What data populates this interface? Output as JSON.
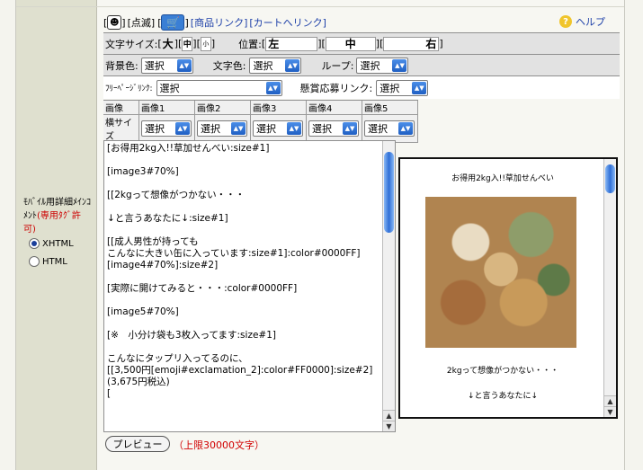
{
  "toolbar": {
    "blink_label": "[点滅]",
    "product_link": "[商品リンク]",
    "cart_link": "[カートへリンク]",
    "help_label": "ヘルプ"
  },
  "font_row": {
    "size_label": "文字サイズ:",
    "sizes": [
      "大",
      "中",
      "小"
    ],
    "position_label": "位置:",
    "positions": [
      "左",
      "中",
      "右"
    ]
  },
  "color_row": {
    "bg_label": "背景色:",
    "text_color_label": "文字色:",
    "loop_label": "ループ:",
    "select_value": "選択"
  },
  "link_row": {
    "free_page_label": "ﾌﾘｰﾍﾟｰｼﾞﾘﾝｸ:",
    "free_page_value": "選択",
    "contest_label": "懸賞応募リンク:",
    "contest_value": "選択"
  },
  "image_grid": {
    "header_left": "画像",
    "row_label": "横サイズ",
    "columns": [
      "画像1",
      "画像2",
      "画像3",
      "画像4",
      "画像5"
    ],
    "select_value": "選択"
  },
  "side": {
    "label_black": "ﾓﾊﾞｲﾙ用詳細ﾒｲﾝｺﾒﾝﾄ",
    "label_red": "(専用ﾀｸﾞ許可)",
    "radio_xhtml": "XHTML",
    "radio_html": "HTML"
  },
  "editor": {
    "content": "[お得用2kg入!!草加せんべい:size#1]\n\n[image3#70%]\n\n[[2kgって想像がつかない・・・\n\n↓と言うあなたに↓:size#1]\n\n[[成人男性が持っても\nこんなに大きい缶に入っています:size#1]:color#0000FF]\n[image4#70%]:size#2]\n\n[実際に開けてみると・・・:color#0000FF]\n\n[image5#70%]\n\n[※　小分け袋も3枚入ってます:size#1]\n\nこんなにタップリ入ってるのに、\n[[3,500円[emoji#exclamation_2]:color#FF0000]:size#2]\n(3,675円税込)\n["
  },
  "preview": {
    "title": "お得用2kg入!!草加せんべい",
    "line1": "2kgって想像がつかない・・・",
    "line2": "↓と言うあなたに↓"
  },
  "footer": {
    "preview_button": "プレビュー",
    "limit_note": "（上限30000文字）"
  }
}
